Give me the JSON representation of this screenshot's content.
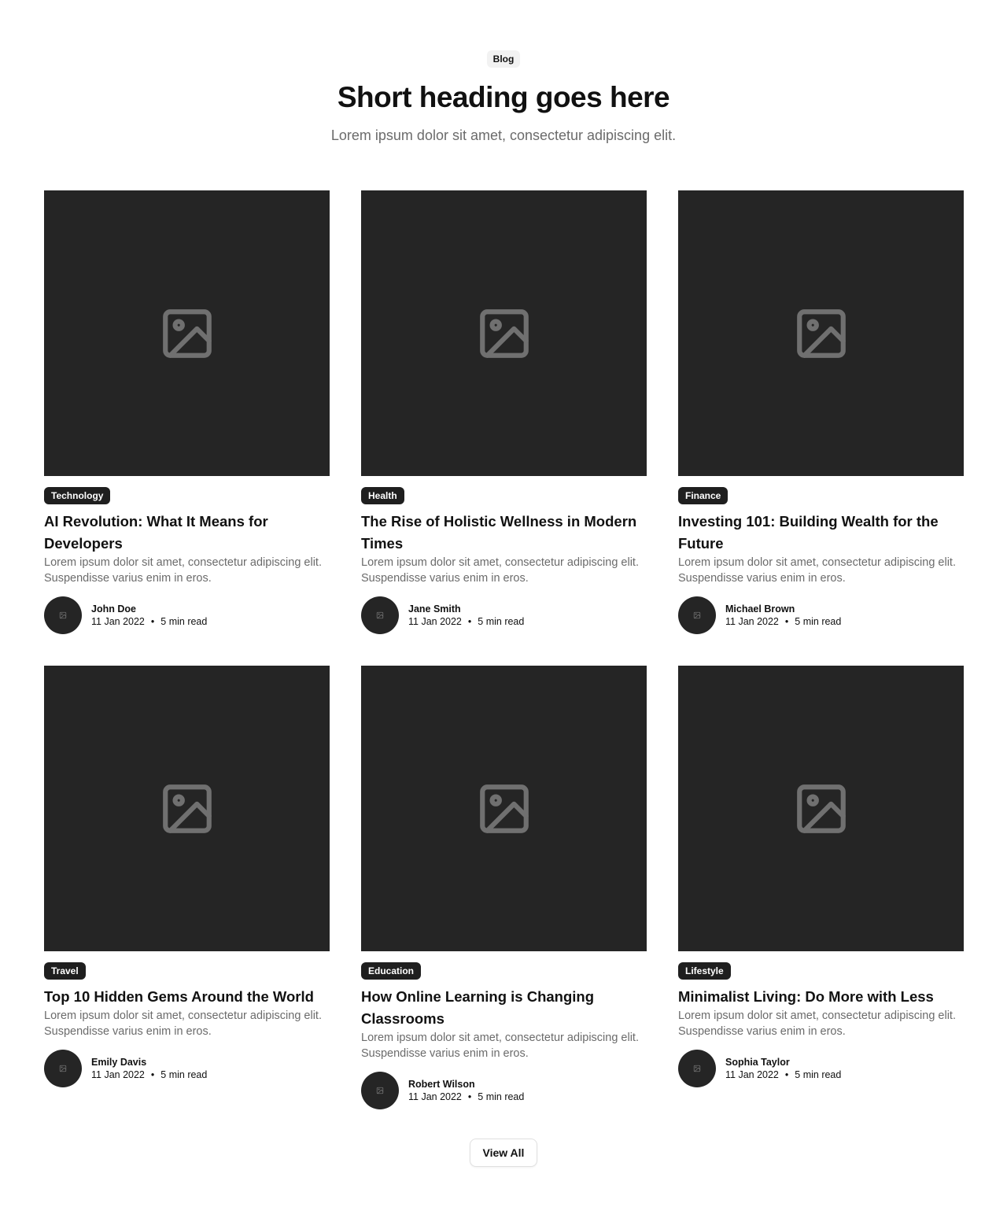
{
  "header": {
    "eyebrow": "Blog",
    "title": "Short heading goes here",
    "subtitle": "Lorem ipsum dolor sit amet, consectetur adipiscing elit."
  },
  "colors": {
    "image_bg": "#252525",
    "tag_bg": "#1f1f1f",
    "muted_text": "#6b6b6b",
    "placeholder_icon": "#707070"
  },
  "icons": {
    "image_placeholder": "image-icon"
  },
  "posts": [
    {
      "tag": "Technology",
      "title": "AI Revolution: What It Means for Developers",
      "description": "Lorem ipsum dolor sit amet, consectetur adipiscing elit. Suspendisse varius enim in eros.",
      "author": "John Doe",
      "date": "11 Jan 2022",
      "read_time": "5 min read"
    },
    {
      "tag": "Health",
      "title": "The Rise of Holistic Wellness in Modern Times",
      "description": "Lorem ipsum dolor sit amet, consectetur adipiscing elit. Suspendisse varius enim in eros.",
      "author": "Jane Smith",
      "date": "11 Jan 2022",
      "read_time": "5 min read"
    },
    {
      "tag": "Finance",
      "title": "Investing 101: Building Wealth for the Future",
      "description": "Lorem ipsum dolor sit amet, consectetur adipiscing elit. Suspendisse varius enim in eros.",
      "author": "Michael Brown",
      "date": "11 Jan 2022",
      "read_time": "5 min read"
    },
    {
      "tag": "Travel",
      "title": "Top 10 Hidden Gems Around the World",
      "description": "Lorem ipsum dolor sit amet, consectetur adipiscing elit. Suspendisse varius enim in eros.",
      "author": "Emily Davis",
      "date": "11 Jan 2022",
      "read_time": "5 min read"
    },
    {
      "tag": "Education",
      "title": "How Online Learning is Changing Classrooms",
      "description": "Lorem ipsum dolor sit amet, consectetur adipiscing elit. Suspendisse varius enim in eros.",
      "author": "Robert Wilson",
      "date": "11 Jan 2022",
      "read_time": "5 min read"
    },
    {
      "tag": "Lifestyle",
      "title": "Minimalist Living: Do More with Less",
      "description": "Lorem ipsum dolor sit amet, consectetur adipiscing elit. Suspendisse varius enim in eros.",
      "author": "Sophia Taylor",
      "date": "11 Jan 2022",
      "read_time": "5 min read"
    }
  ],
  "footer": {
    "view_all_label": "View All"
  }
}
